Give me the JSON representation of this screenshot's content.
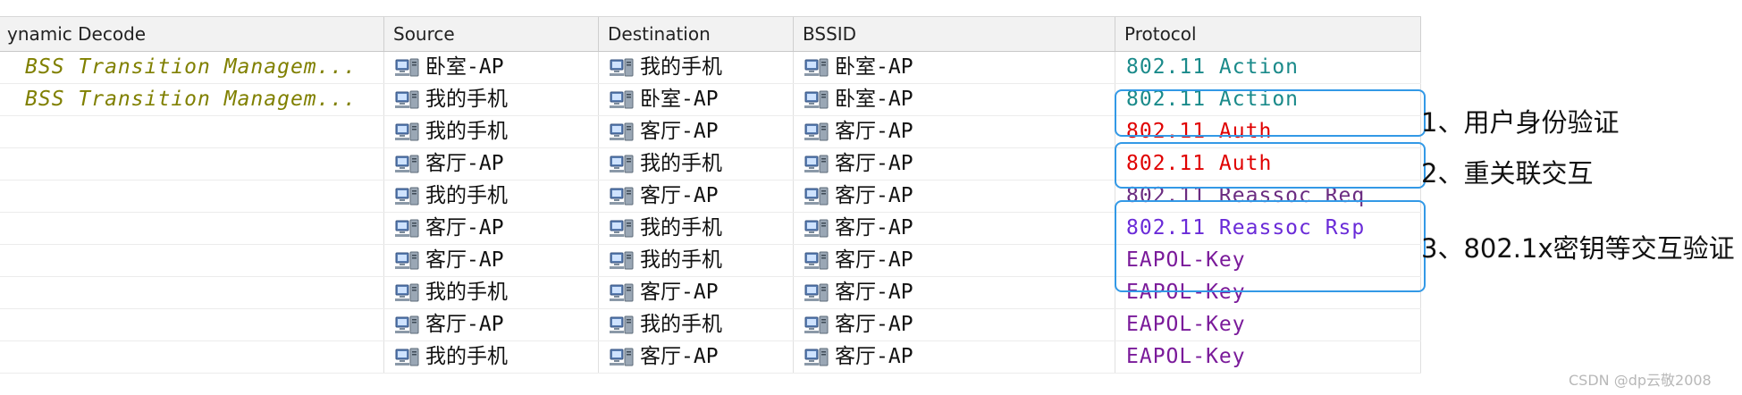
{
  "columns": {
    "dynamic_decode": "ynamic Decode",
    "source": "Source",
    "destination": "Destination",
    "bssid": "BSSID",
    "protocol": "Protocol"
  },
  "rows": [
    {
      "dynamic": "BSS Transition Managem...",
      "source": "卧室-AP",
      "destination": "我的手机",
      "bssid": "卧室-AP",
      "protocol": "802.11 Action",
      "protocol_color": "#1a8a8a"
    },
    {
      "dynamic": "BSS Transition Managem...",
      "source": "我的手机",
      "destination": "卧室-AP",
      "bssid": "卧室-AP",
      "protocol": "802.11 Action",
      "protocol_color": "#1a8a8a"
    },
    {
      "dynamic": "",
      "source": "我的手机",
      "destination": "客厅-AP",
      "bssid": "客厅-AP",
      "protocol": "802.11 Auth",
      "protocol_color": "#e00000"
    },
    {
      "dynamic": "",
      "source": "客厅-AP",
      "destination": "我的手机",
      "bssid": "客厅-AP",
      "protocol": "802.11 Auth",
      "protocol_color": "#e00000"
    },
    {
      "dynamic": "",
      "source": "我的手机",
      "destination": "客厅-AP",
      "bssid": "客厅-AP",
      "protocol": "802.11 Reassoc Req",
      "protocol_color": "#6a2b80"
    },
    {
      "dynamic": "",
      "source": "客厅-AP",
      "destination": "我的手机",
      "bssid": "客厅-AP",
      "protocol": "802.11 Reassoc Rsp",
      "protocol_color": "#6a2bd8"
    },
    {
      "dynamic": "",
      "source": "客厅-AP",
      "destination": "我的手机",
      "bssid": "客厅-AP",
      "protocol": "EAPOL-Key",
      "protocol_color": "#7a1a9a"
    },
    {
      "dynamic": "",
      "source": "我的手机",
      "destination": "客厅-AP",
      "bssid": "客厅-AP",
      "protocol": "EAPOL-Key",
      "protocol_color": "#7a1a9a"
    },
    {
      "dynamic": "",
      "source": "客厅-AP",
      "destination": "我的手机",
      "bssid": "客厅-AP",
      "protocol": "EAPOL-Key",
      "protocol_color": "#7a1a9a"
    },
    {
      "dynamic": "",
      "source": "我的手机",
      "destination": "客厅-AP",
      "bssid": "客厅-AP",
      "protocol": "EAPOL-Key",
      "protocol_color": "#7a1a9a"
    }
  ],
  "annotations": {
    "auth": "1、用户身份验证",
    "reassoc": "2、重关联交互",
    "eapol": "3、802.1x密钥等交互验证"
  },
  "annotation_box_color": "#3399e6",
  "watermark": "CSDN @dp云敬2008"
}
